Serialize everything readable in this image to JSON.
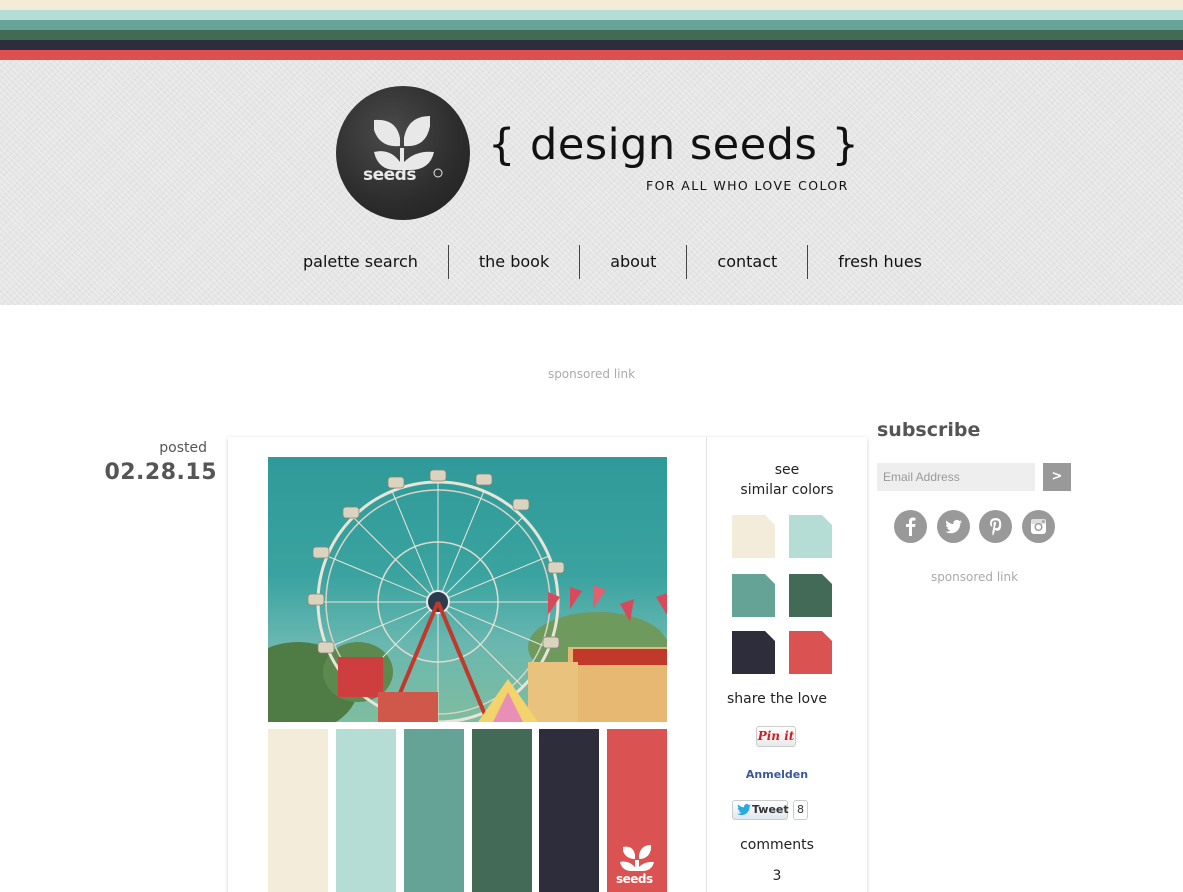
{
  "stripes": [
    "#f4ecd9",
    "#b3ddd6",
    "#67a397",
    "#416b55",
    "#2e2d3e",
    "#db5151"
  ],
  "brand": {
    "logo_word": "seeds",
    "title": "{ design seeds }",
    "tagline": "FOR ALL WHO LOVE COLOR"
  },
  "nav": {
    "items": [
      "palette search",
      "the book",
      "about",
      "contact",
      "fresh hues"
    ]
  },
  "sponsored_top": "sponsored link",
  "post": {
    "posted_label": "posted",
    "date": "02.28.15",
    "palette": [
      "#f4ecdb",
      "#b5ddd6",
      "#64a396",
      "#436a56",
      "#2e2d3c",
      "#da5252"
    ],
    "watermark": "seeds"
  },
  "side": {
    "see_label_line1": "see",
    "see_label_line2": "similar colors",
    "share_label": "share the love",
    "pinit_label": "Pin it",
    "anmelden_label": "Anmelden",
    "tweet_label": "Tweet",
    "tweet_count": "8",
    "comments_label": "comments",
    "comments_count": "3"
  },
  "sidebar": {
    "subscribe_title": "subscribe",
    "email_placeholder": "Email Address",
    "submit_label": ">",
    "social_icons": [
      "facebook-icon",
      "twitter-icon",
      "pinterest-icon",
      "instagram-icon"
    ],
    "sponsored": "sponsored link"
  }
}
